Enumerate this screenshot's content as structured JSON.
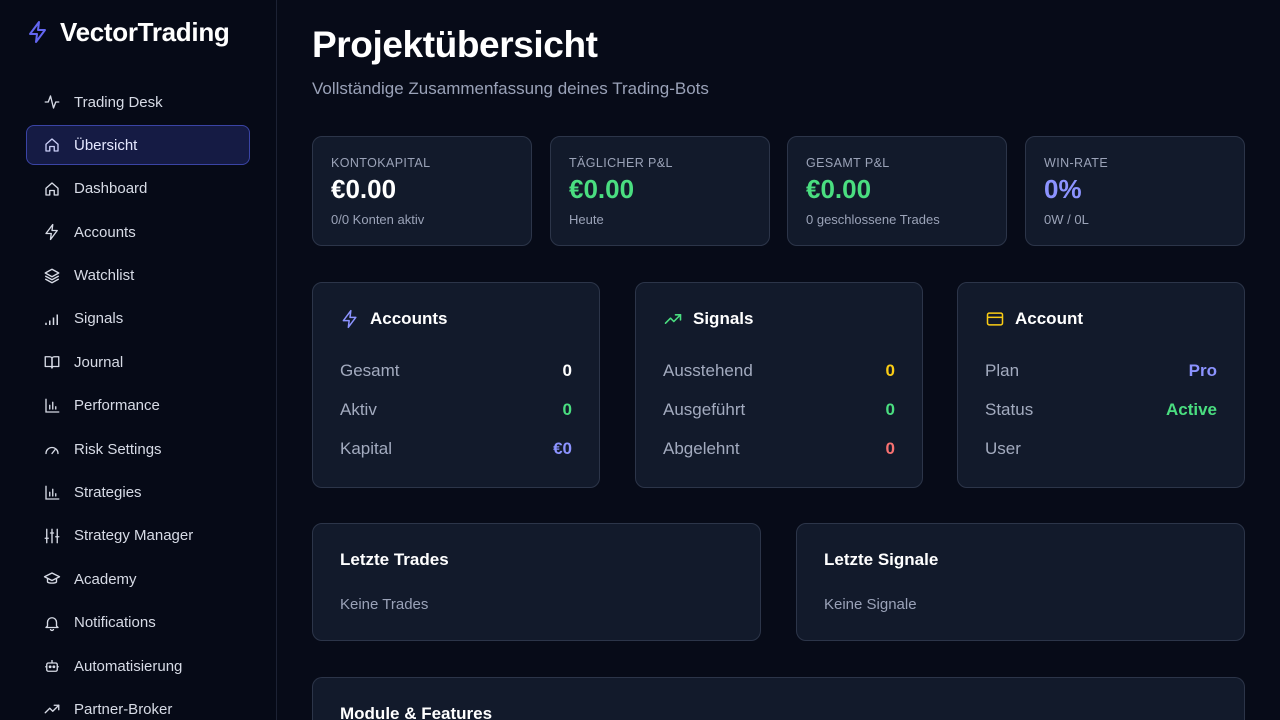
{
  "brand": {
    "name": "VectorTrading",
    "icon": "bolt-icon",
    "accent": "#6366f1"
  },
  "sidebar": {
    "items": [
      {
        "label": "Trading Desk",
        "icon": "activity-icon",
        "active": false
      },
      {
        "label": "Übersicht",
        "icon": "home-icon",
        "active": true
      },
      {
        "label": "Dashboard",
        "icon": "home-icon",
        "active": false
      },
      {
        "label": "Accounts",
        "icon": "bolt-icon",
        "active": false
      },
      {
        "label": "Watchlist",
        "icon": "layers-icon",
        "active": false
      },
      {
        "label": "Signals",
        "icon": "signal-bars-icon",
        "active": false
      },
      {
        "label": "Journal",
        "icon": "book-icon",
        "active": false
      },
      {
        "label": "Performance",
        "icon": "bar-chart-icon",
        "active": false
      },
      {
        "label": "Risk Settings",
        "icon": "gauge-icon",
        "active": false
      },
      {
        "label": "Strategies",
        "icon": "bar-chart-icon",
        "active": false
      },
      {
        "label": "Strategy Manager",
        "icon": "sliders-icon",
        "active": false
      },
      {
        "label": "Academy",
        "icon": "graduation-cap-icon",
        "active": false
      },
      {
        "label": "Notifications",
        "icon": "bell-icon",
        "active": false
      },
      {
        "label": "Automatisierung",
        "icon": "bot-icon",
        "active": false
      },
      {
        "label": "Partner-Broker",
        "icon": "trending-up-icon",
        "active": false
      }
    ]
  },
  "header": {
    "title": "Projektübersicht",
    "subtitle": "Vollständige Zusammenfassung deines Trading-Bots"
  },
  "stats": [
    {
      "label": "KONTOKAPITAL",
      "value": "€0.00",
      "sub": "0/0 Konten aktiv",
      "color": "#ffffff"
    },
    {
      "label": "TÄGLICHER P&L",
      "value": "€0.00",
      "sub": "Heute",
      "color": "#4ade80"
    },
    {
      "label": "GESAMT P&L",
      "value": "€0.00",
      "sub": "0 geschlossene Trades",
      "color": "#4ade80"
    },
    {
      "label": "WIN-RATE",
      "value": "0%",
      "sub": "0W / 0L",
      "color": "#8c93ff"
    }
  ],
  "panels": {
    "accounts": {
      "title": "Accounts",
      "icon": "bolt-icon",
      "rows": [
        {
          "label": "Gesamt",
          "value": "0"
        },
        {
          "label": "Aktiv",
          "value": "0"
        },
        {
          "label": "Kapital",
          "value": "€0"
        }
      ]
    },
    "signals": {
      "title": "Signals",
      "icon": "trending-up-icon",
      "rows": [
        {
          "label": "Ausstehend",
          "value": "0"
        },
        {
          "label": "Ausgeführt",
          "value": "0"
        },
        {
          "label": "Abgelehnt",
          "value": "0"
        }
      ]
    },
    "account": {
      "title": "Account",
      "icon": "credit-card-icon",
      "rows": [
        {
          "label": "Plan",
          "value": "Pro"
        },
        {
          "label": "Status",
          "value": "Active"
        },
        {
          "label": "User",
          "value": ""
        }
      ]
    }
  },
  "recent_trades": {
    "title": "Letzte Trades",
    "empty": "Keine Trades"
  },
  "recent_signals": {
    "title": "Letzte Signale",
    "empty": "Keine Signale"
  },
  "modules": {
    "title": "Module & Features"
  },
  "colors": {
    "background": "#070b18",
    "card": "#121a2b",
    "green": "#4ade80",
    "blue": "#8c93ff",
    "yellow": "#facc15",
    "red": "#f87171"
  }
}
